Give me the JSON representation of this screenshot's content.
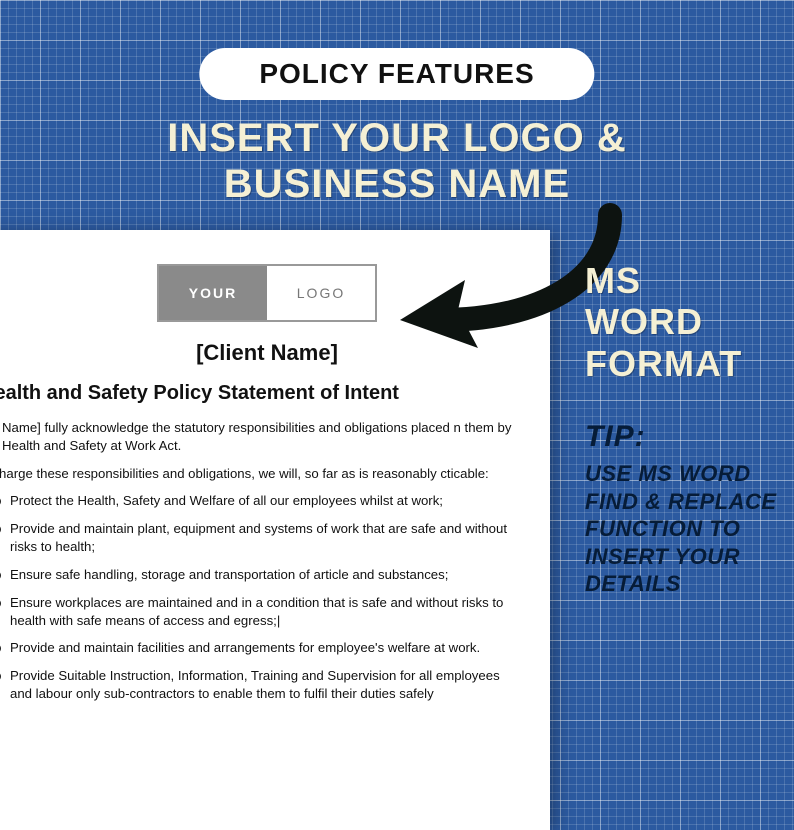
{
  "pill": "POLICY FEATURES",
  "headline_l1": "INSERT YOUR LOGO &",
  "headline_l2": "BUSINESS NAME",
  "logo": {
    "left": "YOUR",
    "right": "LOGO"
  },
  "doc": {
    "client": "[Client Name]",
    "title": "Health and Safety Policy Statement of Intent",
    "p1": "ent Name] fully acknowledge the statutory responsibilities and obligations placed n them by the Health and Safety at Work Act.",
    "p2": "lischarge these responsibilities and obligations, we will, so far as is reasonably cticable:",
    "bullets": [
      "Protect the Health, Safety and Welfare of all our employees whilst at work;",
      "Provide and maintain plant, equipment and systems of work that are safe and without risks to health;",
      "Ensure safe handling, storage and transportation of article and substances;",
      "Ensure workplaces are maintained and in a condition that is safe and without risks to health with safe means of access and egress;|",
      "Provide and maintain facilities and arrangements for employee's welfare at work.",
      "Provide Suitable Instruction, Information, Training and Supervision for all employees and labour only sub-contractors to enable them to fulfil their duties safely"
    ]
  },
  "side": {
    "ms1": "MS",
    "ms2": "WORD",
    "ms3": "FORMAT",
    "tip_label": "TIP:",
    "tip_body": "USE MS WORD FIND & REPLACE FUNCTION TO INSERT YOUR DETAILS"
  }
}
